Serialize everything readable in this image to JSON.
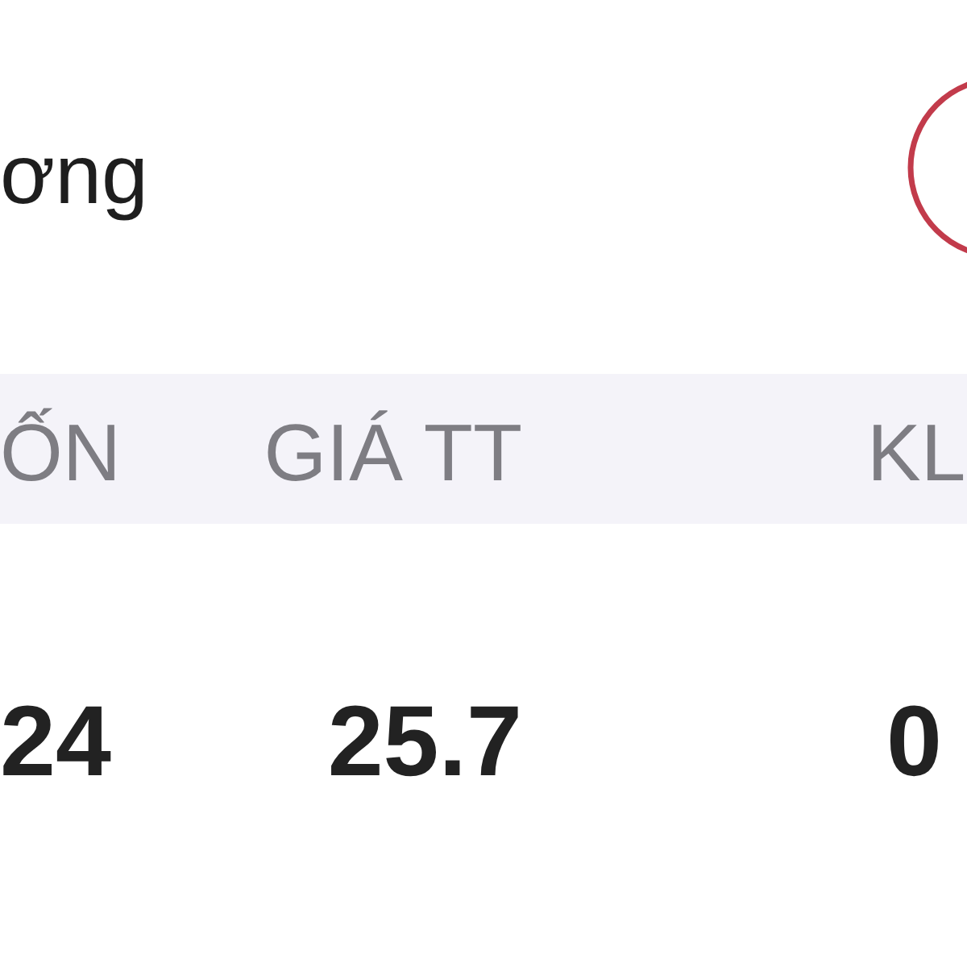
{
  "header": {
    "title": "ơng"
  },
  "table": {
    "columns": [
      "ỐN",
      "GIÁ TT",
      "KL"
    ],
    "rows": [
      [
        "24",
        "25.7",
        "0"
      ]
    ]
  }
}
